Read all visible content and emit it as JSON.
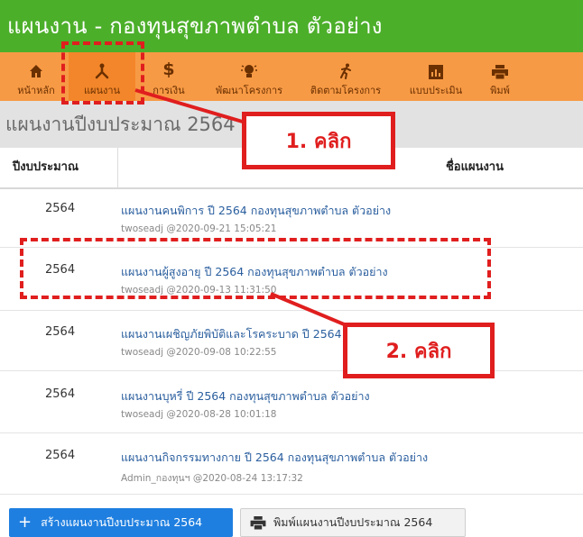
{
  "header": {
    "title": "แผนงาน - กองทุนสุขภาพตำบล ตัวอย่าง"
  },
  "nav": {
    "items": [
      {
        "label": "หน้าหลัก",
        "icon": "home-icon"
      },
      {
        "label": "แผนงาน",
        "icon": "plan-icon",
        "active": true
      },
      {
        "label": "การเงิน",
        "icon": "dollar-icon"
      },
      {
        "label": "พัฒนาโครงการ",
        "icon": "idea-icon"
      },
      {
        "label": "ติดตามโครงการ",
        "icon": "runner-icon"
      },
      {
        "label": "แบบประเมิน",
        "icon": "chart-icon"
      },
      {
        "label": "พิมพ์",
        "icon": "printer-icon"
      }
    ]
  },
  "section": {
    "title": "แผนงานปีงบประมาณ 2564"
  },
  "table": {
    "headers": {
      "year": "ปีงบประมาณ",
      "name": "ชื่อแผนงาน"
    },
    "rows": [
      {
        "year": "2564",
        "plan": "แผนงานคนพิการ ปี 2564 กองทุนสุขภาพตำบล ตัวอย่าง",
        "meta": "twoseadj @2020-09-21 15:05:21"
      },
      {
        "year": "2564",
        "plan": "แผนงานผู้สูงอายุ ปี 2564 กองทุนสุขภาพตำบล ตัวอย่าง",
        "meta": "twoseadj @2020-09-13 11:31:50"
      },
      {
        "year": "2564",
        "plan": "แผนงานเผชิญภัยพิบัติและโรคระบาด ปี 2564 กองทุนสุขภาพตำบล ตัวอย่าง",
        "meta": "twoseadj @2020-09-08 10:22:55"
      },
      {
        "year": "2564",
        "plan": "แผนงานบุหรี่ ปี 2564 กองทุนสุขภาพตำบล ตัวอย่าง",
        "meta": "twoseadj @2020-08-28 10:01:18"
      },
      {
        "year": "2564",
        "plan": "แผนงานกิจกรรมทางกาย ปี 2564 กองทุนสุขภาพตำบล ตัวอย่าง",
        "meta": "Admin_กองทุนฯ @2020-08-24 13:17:32"
      }
    ]
  },
  "buttons": {
    "create": "สร้างแผนงานปีงบประมาณ 2564",
    "print": "พิมพ์แผนงานปีงบประมาณ 2564"
  },
  "annotations": {
    "step1": "1. คลิก",
    "step2": "2. คลิก",
    "color": "#e01e1e"
  },
  "colors": {
    "header_green": "#4caf2a",
    "nav_orange": "#f79a45",
    "link_blue": "#2a5e9e",
    "primary_blue": "#1f7fe0"
  }
}
